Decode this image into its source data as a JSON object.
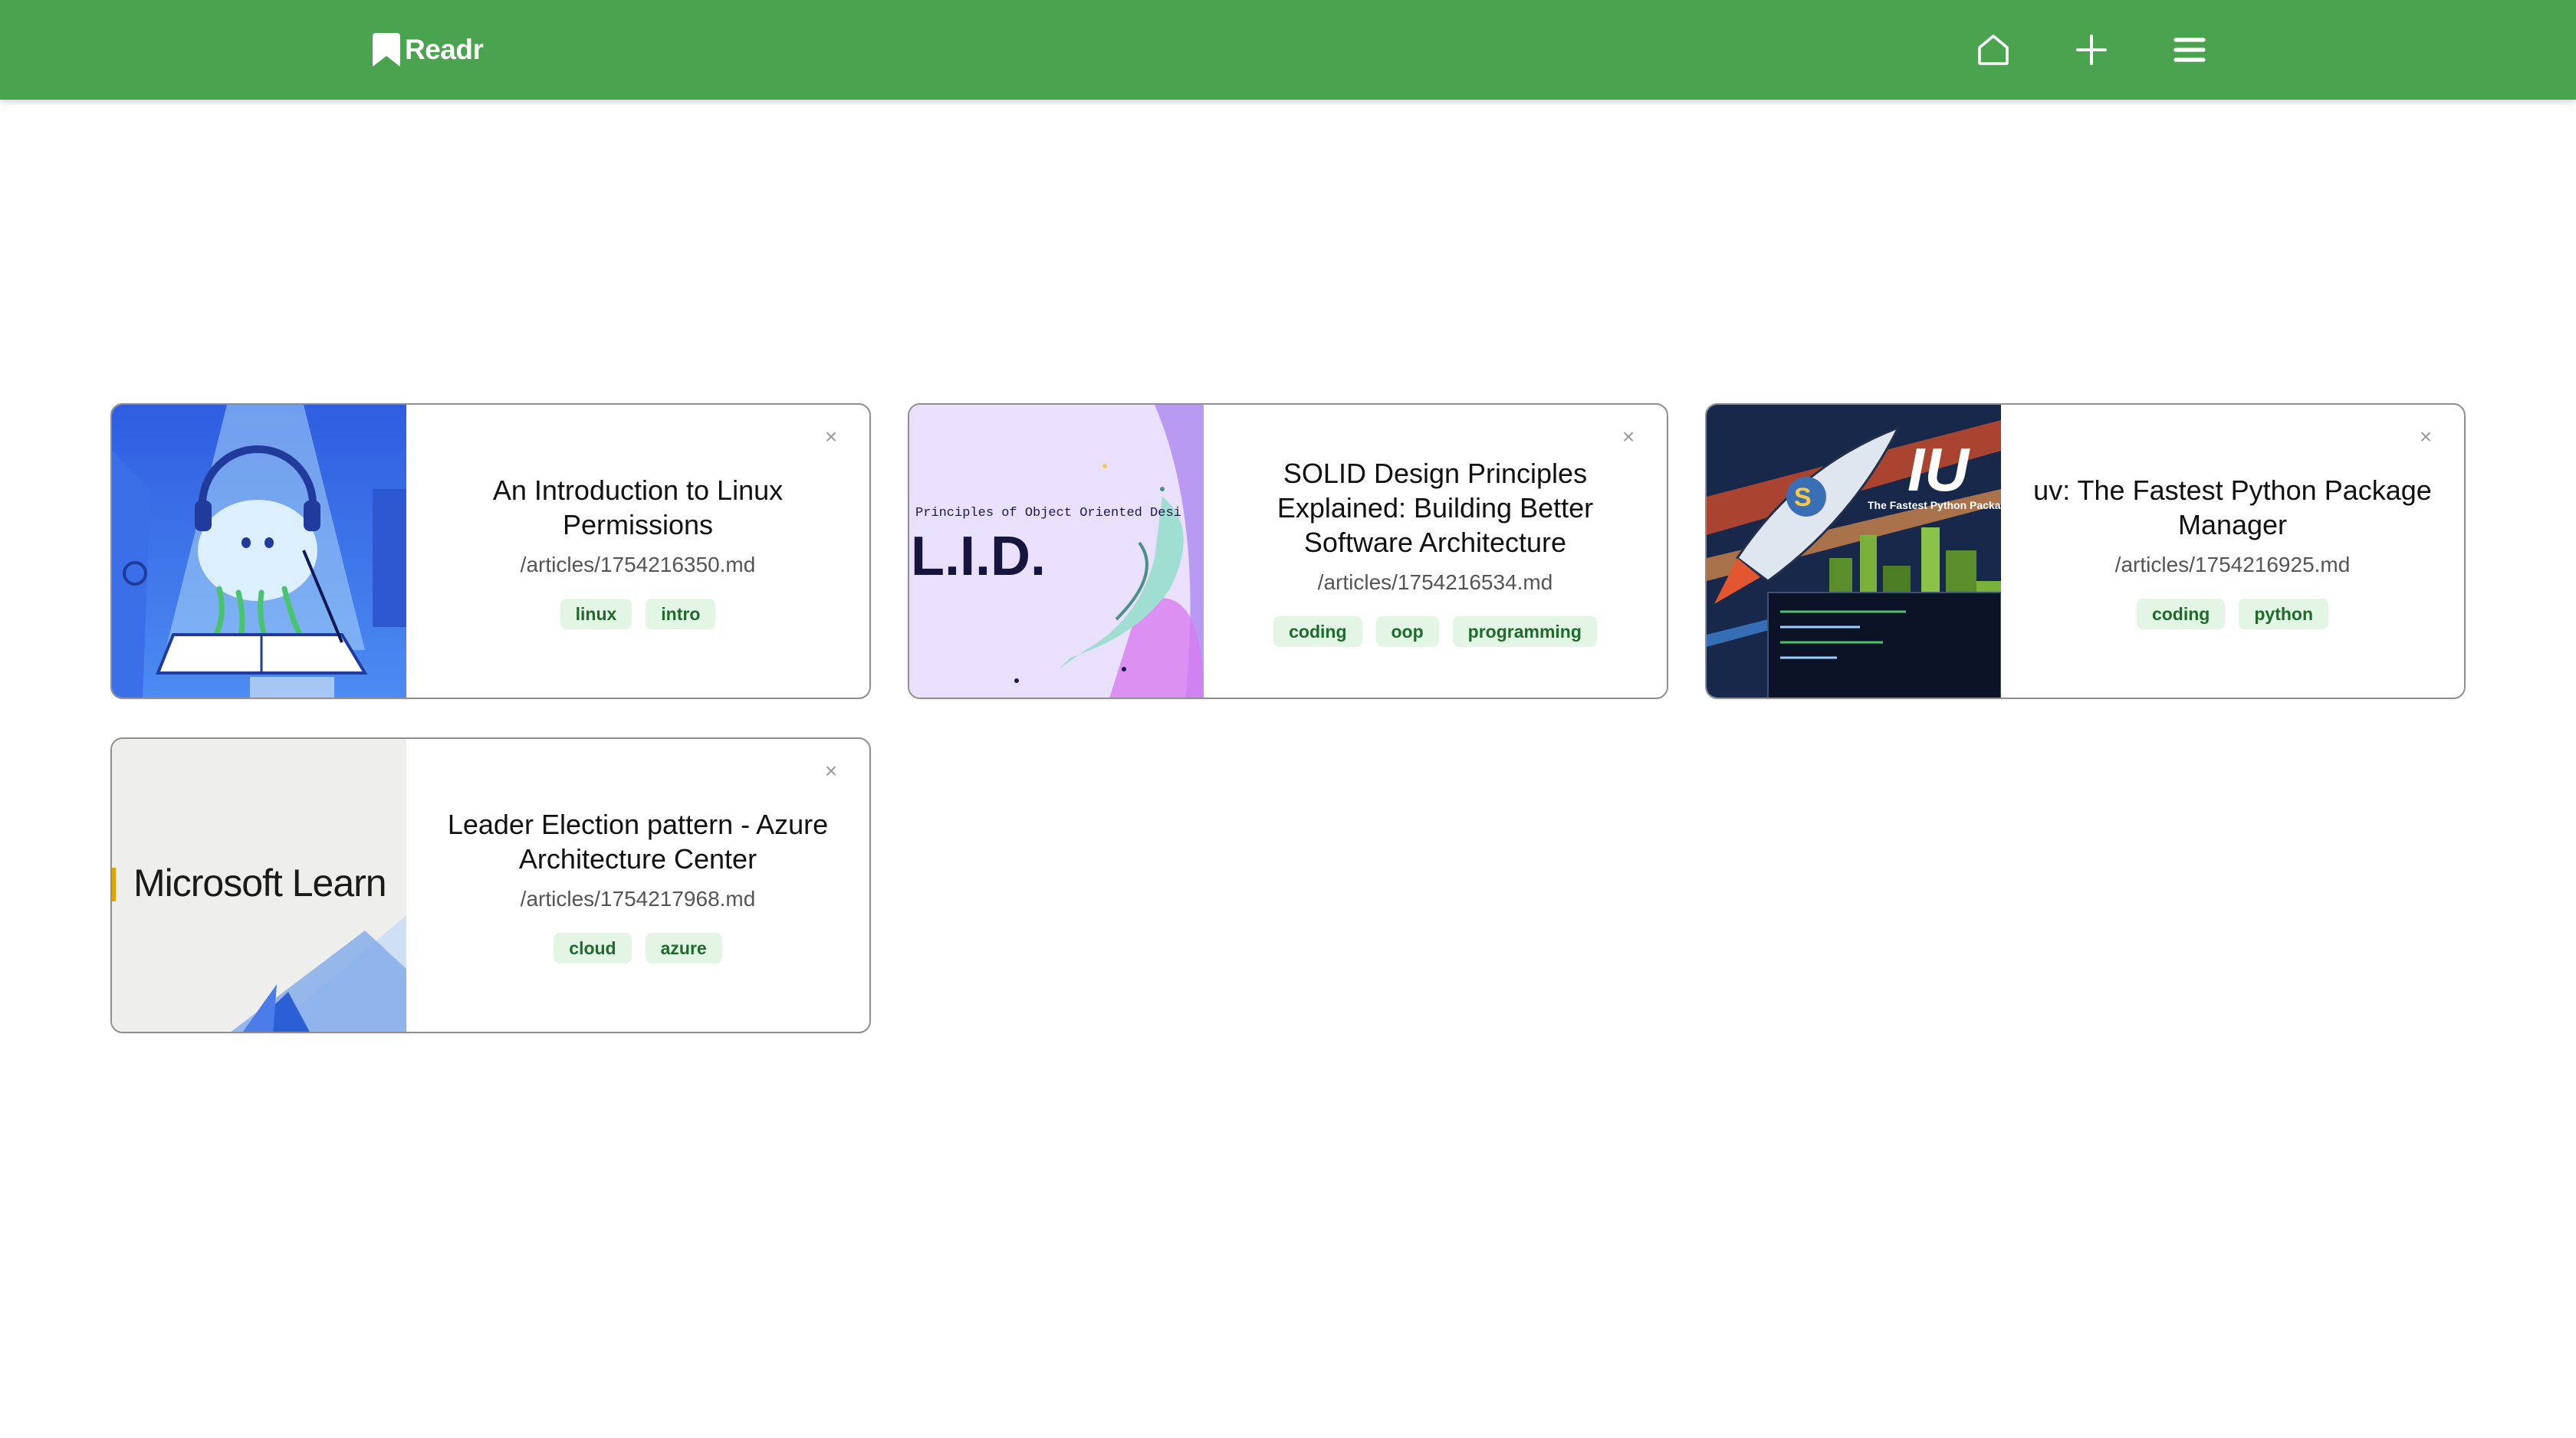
{
  "app": {
    "brand": "Readr",
    "colors": {
      "navbar": "#4aa44f",
      "tag_bg": "#e3f5e5",
      "tag_text": "#1e6b2b"
    }
  },
  "nav": {
    "home_icon": "home-icon",
    "add_icon": "plus-icon",
    "menu_icon": "hamburger-menu-icon"
  },
  "articles": [
    {
      "title": "An Introduction to Linux Permissions",
      "path": "/articles/1754216350.md",
      "tags": [
        "linux",
        "intro"
      ],
      "thumbnail_text": "",
      "close": "×"
    },
    {
      "title": "SOLID Design Principles Explained: Building Better Software Architecture",
      "path": "/articles/1754216534.md",
      "tags": [
        "coding",
        "oop",
        "programming"
      ],
      "thumbnail_text": "L.I.D.",
      "thumbnail_subtext": "Principles of Object Oriented Desi",
      "close": "×"
    },
    {
      "title": "uv: The Fastest Python Package Manager",
      "path": "/articles/1754216925.md",
      "tags": [
        "coding",
        "python"
      ],
      "thumbnail_text": "IU",
      "thumbnail_subtext": "The Fastest Python Packa",
      "close": "×"
    },
    {
      "title": "Leader Election pattern - Azure Architecture Center",
      "path": "/articles/1754217968.md",
      "tags": [
        "cloud",
        "azure"
      ],
      "thumbnail_text": "Microsoft Learn",
      "close": "×"
    }
  ]
}
